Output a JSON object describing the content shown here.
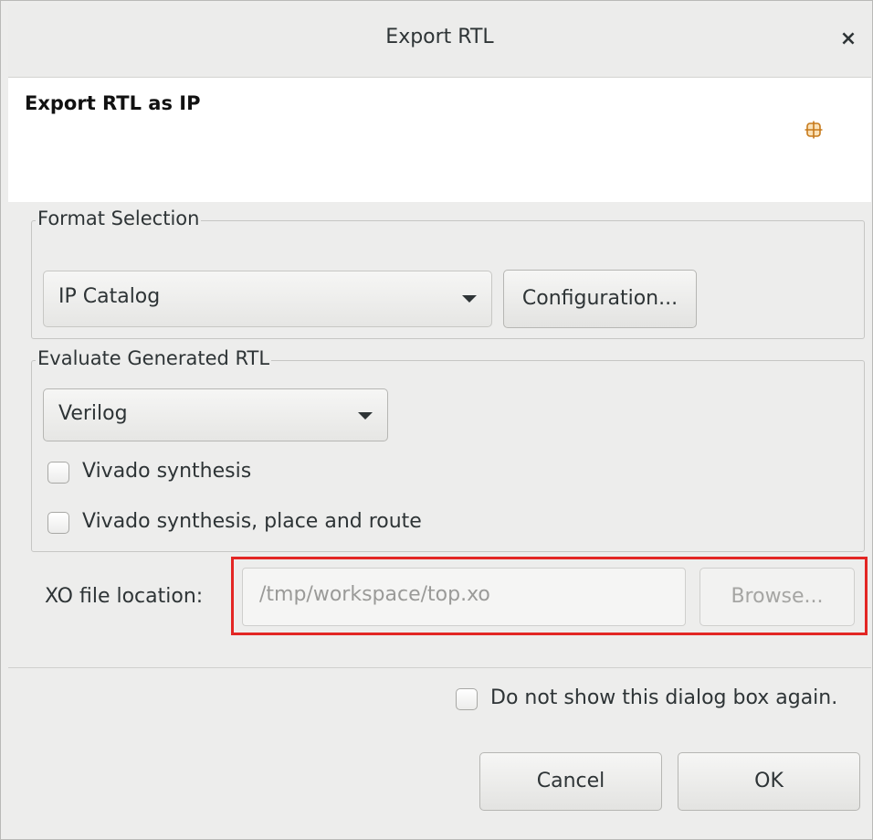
{
  "window": {
    "title": "Export RTL",
    "close_glyph": "×"
  },
  "header": {
    "title": "Export RTL as IP",
    "icon": "grid-icon",
    "icon_color": "#c77a1b"
  },
  "format_selection": {
    "group_label": "Format Selection",
    "format_value": "IP Catalog",
    "configuration_label": "Configuration..."
  },
  "evaluate": {
    "group_label": "Evaluate Generated RTL",
    "language_value": "Verilog",
    "vivado_synthesis_label": "Vivado synthesis",
    "vivado_synthesis_checked": false,
    "vivado_pnr_label": "Vivado synthesis, place and route",
    "vivado_pnr_checked": false
  },
  "xo": {
    "label": "XO file location:",
    "path_value": "/tmp/workspace/top.xo",
    "browse_label": "Browse...",
    "highlight_color": "#e32624"
  },
  "footer": {
    "dont_show_label": "Do not show this dialog box again.",
    "dont_show_checked": false,
    "cancel_label": "Cancel",
    "ok_label": "OK"
  }
}
